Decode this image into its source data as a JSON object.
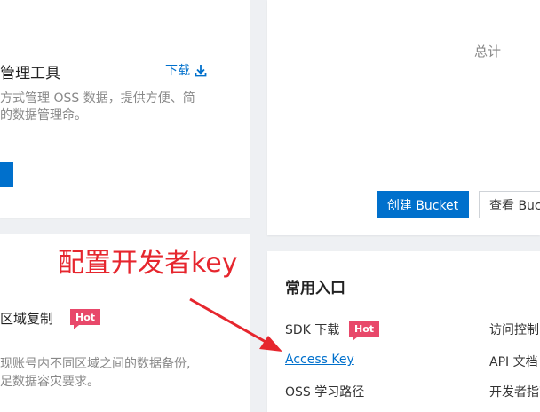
{
  "tool_card": {
    "title": "管理工具",
    "download_label": "下载",
    "desc_line1": "方式管理 OSS 数据，提供方便、简",
    "desc_line2": "的数据管理命。"
  },
  "total_card": {
    "total_label": "总计",
    "create_bucket_label": "创建 Bucket",
    "view_bucket_label": "查看 Bucket"
  },
  "replication_card": {
    "title": "区域复制",
    "hot_label": "Hot",
    "desc_line1": "现账号内不同区域之间的数据备份,",
    "desc_line2": "足数据容灾要求。"
  },
  "entrances_card": {
    "title": "常用入口",
    "links": [
      {
        "label": "SDK 下载",
        "hot": "Hot"
      },
      {
        "label": "Access Key"
      },
      {
        "label": "OSS 学习路径"
      },
      {
        "label": "访问控制"
      },
      {
        "label": "API 文档"
      },
      {
        "label": "开发者指南"
      }
    ]
  },
  "annotation": {
    "text": "配置开发者key",
    "color": "#e6262e"
  },
  "colors": {
    "accent": "#0070cc",
    "hot_badge": "#e8486a",
    "background": "#eef0f3"
  },
  "icons": {
    "download": "download-icon",
    "annotation_arrow": "arrow-icon"
  }
}
